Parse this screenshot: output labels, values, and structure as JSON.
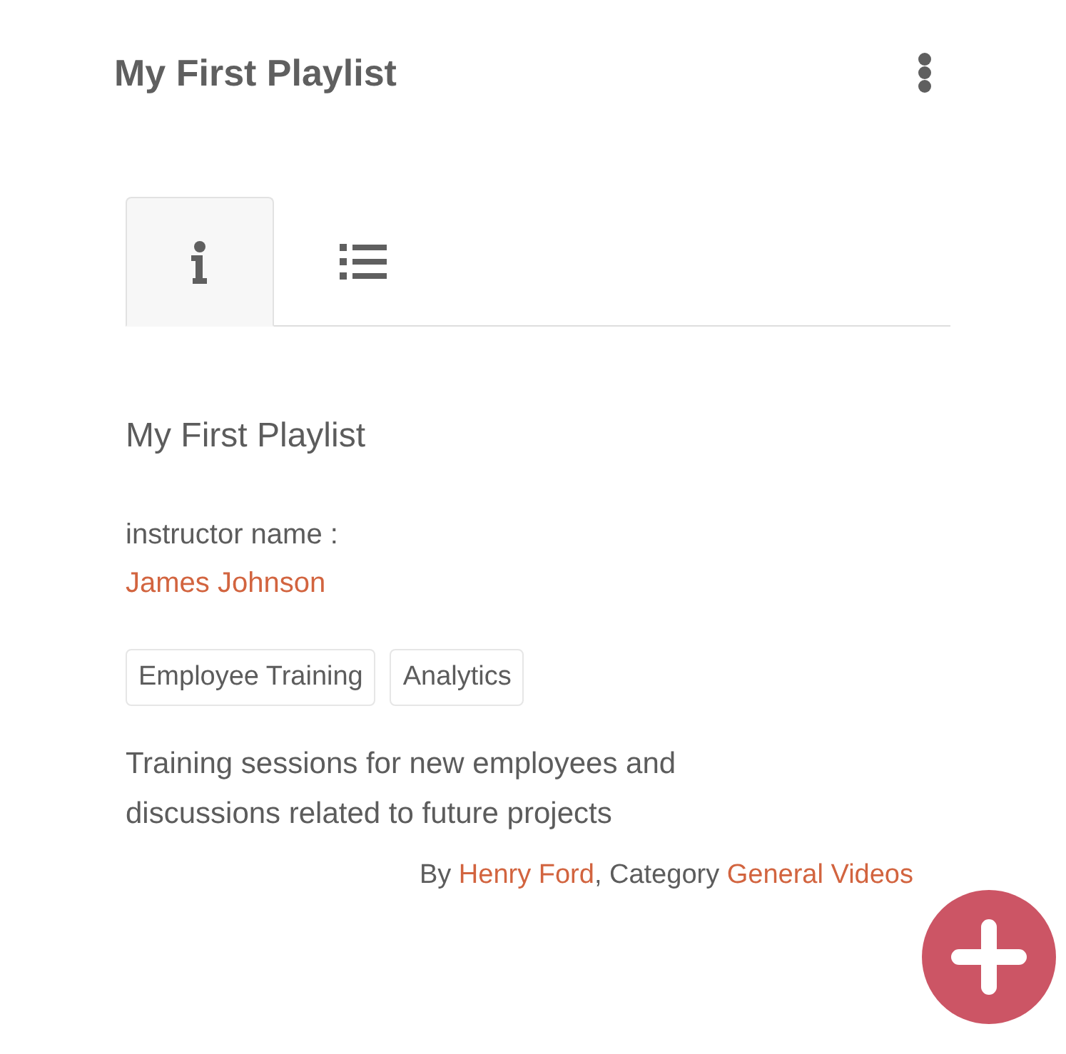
{
  "header": {
    "title": "My First Playlist"
  },
  "tabs": [
    {
      "kind": "info",
      "selected": true
    },
    {
      "kind": "list",
      "selected": false
    }
  ],
  "details": {
    "name": "My First Playlist",
    "instructor_label": "instructor name :",
    "instructor_name": "James Johnson",
    "tags": [
      "Employee Training",
      "Analytics"
    ],
    "description": "Training sessions for new employees and discussions related to future projects",
    "byline": {
      "prefix": "By",
      "author": "Henry Ford",
      "separator": ", Category",
      "category": "General Videos"
    }
  }
}
